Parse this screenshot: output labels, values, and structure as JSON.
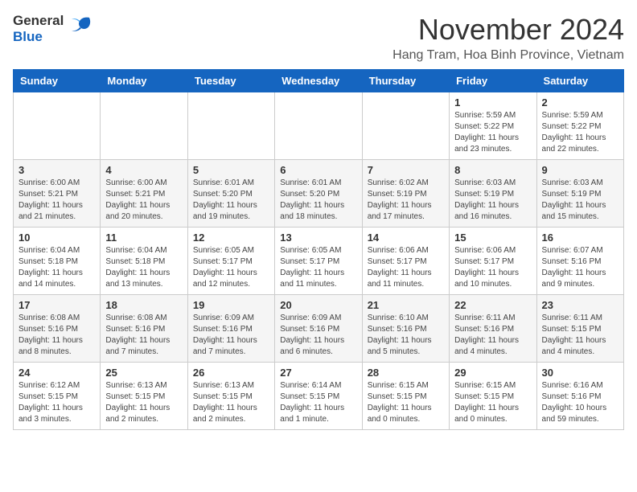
{
  "logo": {
    "general": "General",
    "blue": "Blue"
  },
  "title": "November 2024",
  "location": "Hang Tram, Hoa Binh Province, Vietnam",
  "days_of_week": [
    "Sunday",
    "Monday",
    "Tuesday",
    "Wednesday",
    "Thursday",
    "Friday",
    "Saturday"
  ],
  "weeks": [
    [
      {
        "day": "",
        "info": ""
      },
      {
        "day": "",
        "info": ""
      },
      {
        "day": "",
        "info": ""
      },
      {
        "day": "",
        "info": ""
      },
      {
        "day": "",
        "info": ""
      },
      {
        "day": "1",
        "info": "Sunrise: 5:59 AM\nSunset: 5:22 PM\nDaylight: 11 hours\nand 23 minutes."
      },
      {
        "day": "2",
        "info": "Sunrise: 5:59 AM\nSunset: 5:22 PM\nDaylight: 11 hours\nand 22 minutes."
      }
    ],
    [
      {
        "day": "3",
        "info": "Sunrise: 6:00 AM\nSunset: 5:21 PM\nDaylight: 11 hours\nand 21 minutes."
      },
      {
        "day": "4",
        "info": "Sunrise: 6:00 AM\nSunset: 5:21 PM\nDaylight: 11 hours\nand 20 minutes."
      },
      {
        "day": "5",
        "info": "Sunrise: 6:01 AM\nSunset: 5:20 PM\nDaylight: 11 hours\nand 19 minutes."
      },
      {
        "day": "6",
        "info": "Sunrise: 6:01 AM\nSunset: 5:20 PM\nDaylight: 11 hours\nand 18 minutes."
      },
      {
        "day": "7",
        "info": "Sunrise: 6:02 AM\nSunset: 5:19 PM\nDaylight: 11 hours\nand 17 minutes."
      },
      {
        "day": "8",
        "info": "Sunrise: 6:03 AM\nSunset: 5:19 PM\nDaylight: 11 hours\nand 16 minutes."
      },
      {
        "day": "9",
        "info": "Sunrise: 6:03 AM\nSunset: 5:19 PM\nDaylight: 11 hours\nand 15 minutes."
      }
    ],
    [
      {
        "day": "10",
        "info": "Sunrise: 6:04 AM\nSunset: 5:18 PM\nDaylight: 11 hours\nand 14 minutes."
      },
      {
        "day": "11",
        "info": "Sunrise: 6:04 AM\nSunset: 5:18 PM\nDaylight: 11 hours\nand 13 minutes."
      },
      {
        "day": "12",
        "info": "Sunrise: 6:05 AM\nSunset: 5:17 PM\nDaylight: 11 hours\nand 12 minutes."
      },
      {
        "day": "13",
        "info": "Sunrise: 6:05 AM\nSunset: 5:17 PM\nDaylight: 11 hours\nand 11 minutes."
      },
      {
        "day": "14",
        "info": "Sunrise: 6:06 AM\nSunset: 5:17 PM\nDaylight: 11 hours\nand 11 minutes."
      },
      {
        "day": "15",
        "info": "Sunrise: 6:06 AM\nSunset: 5:17 PM\nDaylight: 11 hours\nand 10 minutes."
      },
      {
        "day": "16",
        "info": "Sunrise: 6:07 AM\nSunset: 5:16 PM\nDaylight: 11 hours\nand 9 minutes."
      }
    ],
    [
      {
        "day": "17",
        "info": "Sunrise: 6:08 AM\nSunset: 5:16 PM\nDaylight: 11 hours\nand 8 minutes."
      },
      {
        "day": "18",
        "info": "Sunrise: 6:08 AM\nSunset: 5:16 PM\nDaylight: 11 hours\nand 7 minutes."
      },
      {
        "day": "19",
        "info": "Sunrise: 6:09 AM\nSunset: 5:16 PM\nDaylight: 11 hours\nand 7 minutes."
      },
      {
        "day": "20",
        "info": "Sunrise: 6:09 AM\nSunset: 5:16 PM\nDaylight: 11 hours\nand 6 minutes."
      },
      {
        "day": "21",
        "info": "Sunrise: 6:10 AM\nSunset: 5:16 PM\nDaylight: 11 hours\nand 5 minutes."
      },
      {
        "day": "22",
        "info": "Sunrise: 6:11 AM\nSunset: 5:16 PM\nDaylight: 11 hours\nand 4 minutes."
      },
      {
        "day": "23",
        "info": "Sunrise: 6:11 AM\nSunset: 5:15 PM\nDaylight: 11 hours\nand 4 minutes."
      }
    ],
    [
      {
        "day": "24",
        "info": "Sunrise: 6:12 AM\nSunset: 5:15 PM\nDaylight: 11 hours\nand 3 minutes."
      },
      {
        "day": "25",
        "info": "Sunrise: 6:13 AM\nSunset: 5:15 PM\nDaylight: 11 hours\nand 2 minutes."
      },
      {
        "day": "26",
        "info": "Sunrise: 6:13 AM\nSunset: 5:15 PM\nDaylight: 11 hours\nand 2 minutes."
      },
      {
        "day": "27",
        "info": "Sunrise: 6:14 AM\nSunset: 5:15 PM\nDaylight: 11 hours\nand 1 minute."
      },
      {
        "day": "28",
        "info": "Sunrise: 6:15 AM\nSunset: 5:15 PM\nDaylight: 11 hours\nand 0 minutes."
      },
      {
        "day": "29",
        "info": "Sunrise: 6:15 AM\nSunset: 5:15 PM\nDaylight: 11 hours\nand 0 minutes."
      },
      {
        "day": "30",
        "info": "Sunrise: 6:16 AM\nSunset: 5:16 PM\nDaylight: 10 hours\nand 59 minutes."
      }
    ]
  ]
}
